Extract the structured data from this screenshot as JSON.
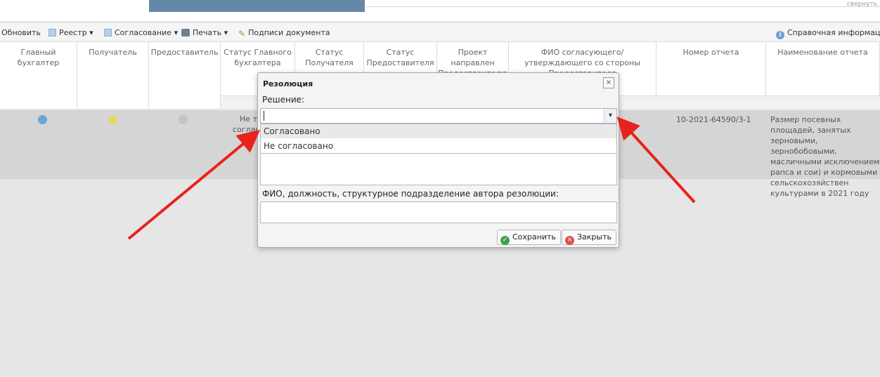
{
  "topbar": {
    "clip_text": "свернуть"
  },
  "toolbar": {
    "refresh": "Обновить",
    "registry": "Реестр ▾",
    "approval": "Согласование ▾",
    "print": "Печать ▾",
    "signatures": "Подписи документа",
    "help": "Справочная информаци"
  },
  "grid": {
    "headers": [
      "Главный бухгалтер",
      "Получатель",
      "Предоставитель",
      "Статус Главного бухгалтера",
      "Статус Получателя",
      "Статус Предоставителя",
      "Проект направлен Предоставителю",
      "ФИО согласующего/утверждающего со стороны Предоставителя",
      "Номер отчета",
      "Наименование отчета"
    ],
    "row": {
      "status_partial": "Не тр",
      "status_partial2": "соглас",
      "report_number": "10-2021-64590/3-1",
      "report_name": "Размер посевных площадей, занятых зерновыми, зернобобовыми, масличными исключением рапса и сои) и кормовыми сельскохозяйствен культурами в 2021 году",
      "colors": {
        "chief": "#6aa7d8",
        "recipient": "#e1db6d",
        "provider": "#c4c4c4"
      }
    }
  },
  "dialog": {
    "title": "Резолюция",
    "close": "×",
    "decision_label": "Решение:",
    "decision_value": "",
    "options": [
      "Согласовано",
      "Не согласовано"
    ],
    "author_label": "ФИО, должность, структурное подразделение автора резолюции:",
    "author_value": "",
    "save": "Сохранить",
    "cancel": "Закрыть"
  },
  "annotation": {
    "arrow_color": "#e8221c"
  }
}
